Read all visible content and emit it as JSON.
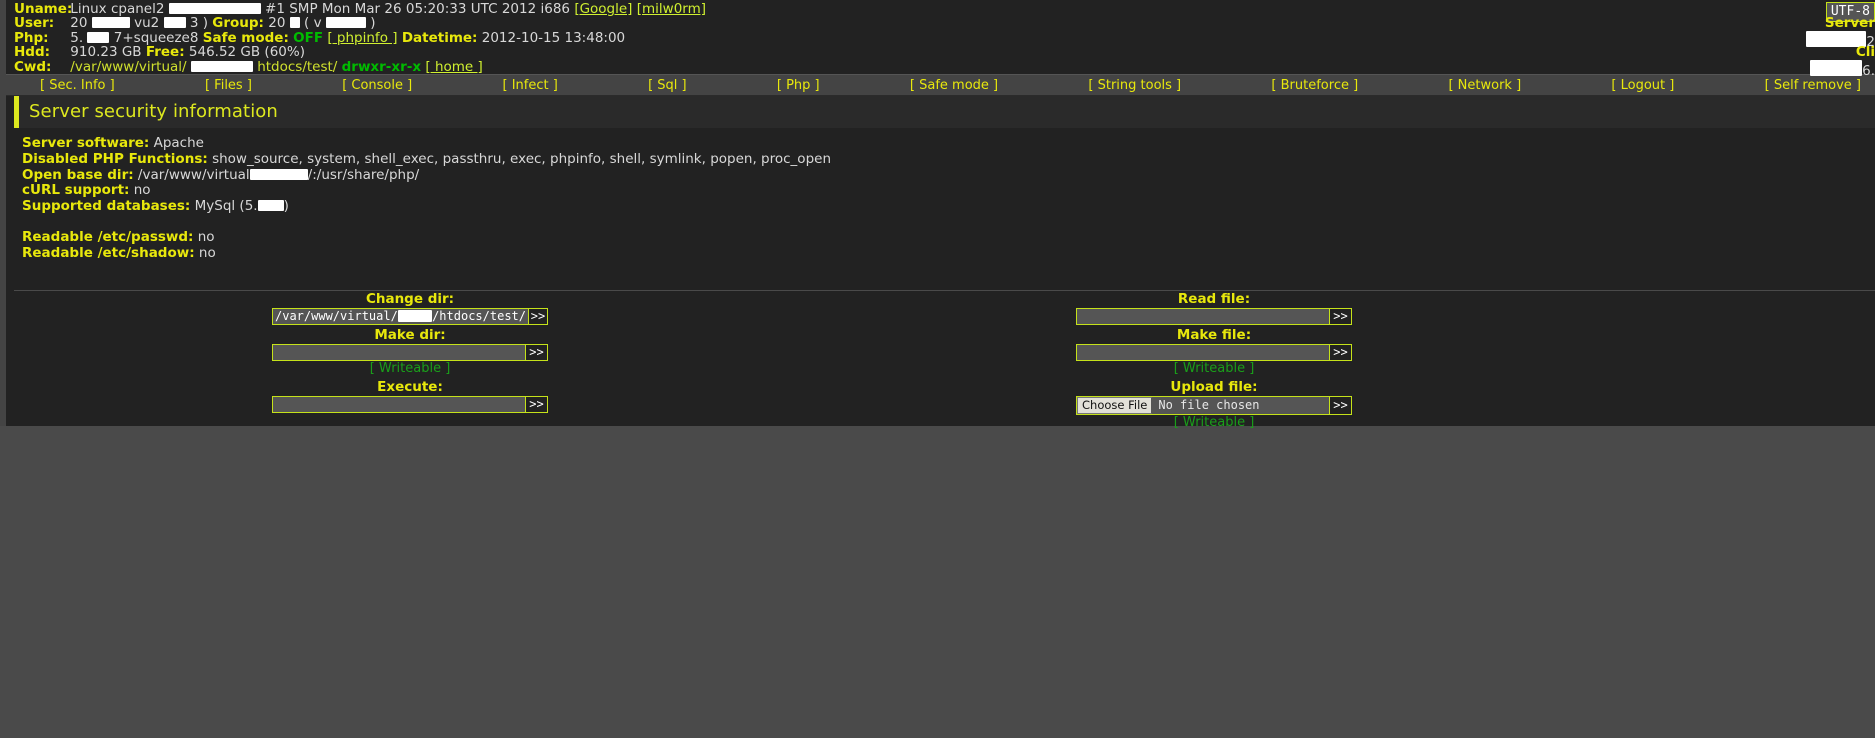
{
  "header": {
    "uname_label": "Uname:",
    "uname_pre": "Linux cpanel2",
    "uname_post": "#1 SMP Mon Mar 26 05:20:33 UTC 2012 i686",
    "google_link": "[Google]",
    "milw0rm_link": "[milw0rm]",
    "user_label": "User:",
    "user_pre": "20",
    "user_mid": "vu2",
    "user_post": "3 )",
    "group_label": "Group:",
    "group_pre": "20",
    "group_open": "( v",
    "group_close": ")",
    "php_label": "Php:",
    "php_pre": "5.",
    "php_post": "7+squeeze8",
    "safe_mode_label": "Safe mode:",
    "safe_mode_value": "OFF",
    "phpinfo_link": "[ phpinfo ]",
    "datetime_label": "Datetime:",
    "datetime_value": "2012-10-15 13:48:00",
    "hdd_label": "Hdd:",
    "hdd_value": "910.23 GB",
    "free_label": "Free:",
    "free_value": "546.52 GB (60%)",
    "cwd_label": "Cwd:",
    "cwd_pre": "/var/www/virtual/",
    "cwd_post": "htdocs/test/",
    "cwd_perms": "drwxr-xr-x",
    "home_link": "[ home ]",
    "charset": "UTF-8",
    "server_ip_label": "Server",
    "server_ip_value": "2",
    "client_ip_label": "Cli",
    "client_ip_value": "6."
  },
  "menu": {
    "items": [
      {
        "label": "[ Sec. Info ]",
        "name": "sec-info"
      },
      {
        "label": "[ Files ]",
        "name": "files"
      },
      {
        "label": "[ Console ]",
        "name": "console"
      },
      {
        "label": "[ Infect ]",
        "name": "infect"
      },
      {
        "label": "[ Sql ]",
        "name": "sql"
      },
      {
        "label": "[ Php ]",
        "name": "php"
      },
      {
        "label": "[ Safe mode ]",
        "name": "safe-mode"
      },
      {
        "label": "[ String tools ]",
        "name": "string-tools"
      },
      {
        "label": "[ Bruteforce ]",
        "name": "bruteforce"
      },
      {
        "label": "[ Network ]",
        "name": "network"
      },
      {
        "label": "[ Logout ]",
        "name": "logout"
      },
      {
        "label": "[ Self remove ]",
        "name": "self-remove"
      }
    ]
  },
  "panel": {
    "title": "Server security information",
    "rows": [
      {
        "label": "Server software:",
        "value": "Apache"
      },
      {
        "label": "Disabled PHP Functions:",
        "value": "show_source, system, shell_exec, passthru, exec, phpinfo, shell, symlink, popen, proc_open"
      },
      {
        "label": "Open base dir:",
        "value": "/var/www/virtual"
      },
      {
        "label": "cURL support:",
        "value": "no"
      },
      {
        "label": "Supported databases:",
        "value": "MySql (5."
      }
    ],
    "open_base_dir_tail": "/:/usr/share/php/",
    "mysql_tail": ")",
    "readable_passwd_label": "Readable /etc/passwd:",
    "readable_passwd_value": "no",
    "readable_shadow_label": "Readable /etc/shadow:",
    "readable_shadow_value": "no"
  },
  "forms": {
    "change_dir": {
      "label": "Change dir:",
      "value_pre": "/var/www/virtual/",
      "value_post": "/htdocs/test/",
      "submit": ">>"
    },
    "make_dir": {
      "label": "Make dir:",
      "value": "",
      "submit": ">>",
      "status": "[ Writeable ]"
    },
    "execute": {
      "label": "Execute:",
      "value": "",
      "submit": ">>"
    },
    "read_file": {
      "label": "Read file:",
      "value": "",
      "submit": ">>"
    },
    "make_file": {
      "label": "Make file:",
      "value": "",
      "submit": ">>",
      "status": "[ Writeable ]"
    },
    "upload_file": {
      "label": "Upload file:",
      "choose_label": "Choose File",
      "no_file_text": "No file chosen",
      "submit": ">>",
      "status": "[ Writeable ]"
    }
  },
  "colors": {
    "accent": "#e8e80c",
    "bg_dark": "#222222",
    "bg_body": "#4a4a4a",
    "green": "#1a9e1a",
    "border": "#c5e21a"
  }
}
